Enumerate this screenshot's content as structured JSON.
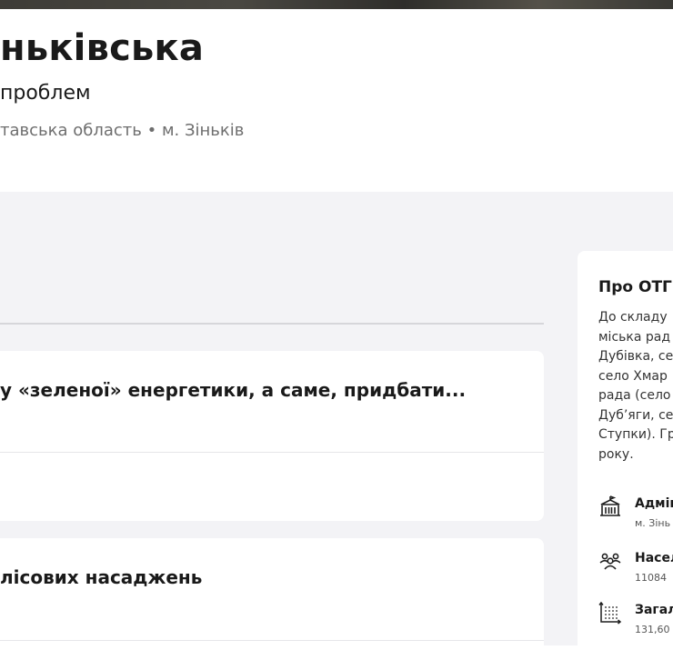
{
  "header": {
    "title": "ньківська",
    "subtitle": "проблем",
    "location": "тавська область • м. Зіньків"
  },
  "cards": [
    {
      "title": "у «зеленої» енергетики, а саме, придбати..."
    },
    {
      "title": "лісових насаджень"
    }
  ],
  "sidebar": {
    "title": "Про ОТГ",
    "description_lines": [
      "До складу",
      "міська рад",
      "Дубівка, се",
      "село Хмар",
      "рада (село",
      "Дуб’яги, се",
      "Ступки). Гр",
      "року."
    ],
    "info": [
      {
        "icon": "city-hall-icon",
        "label": "Адмін",
        "value": "м. Зінь"
      },
      {
        "icon": "population-icon",
        "label": "Насел",
        "value": "11084"
      },
      {
        "icon": "area-icon",
        "label": "Загал",
        "value": "131,60"
      }
    ]
  }
}
